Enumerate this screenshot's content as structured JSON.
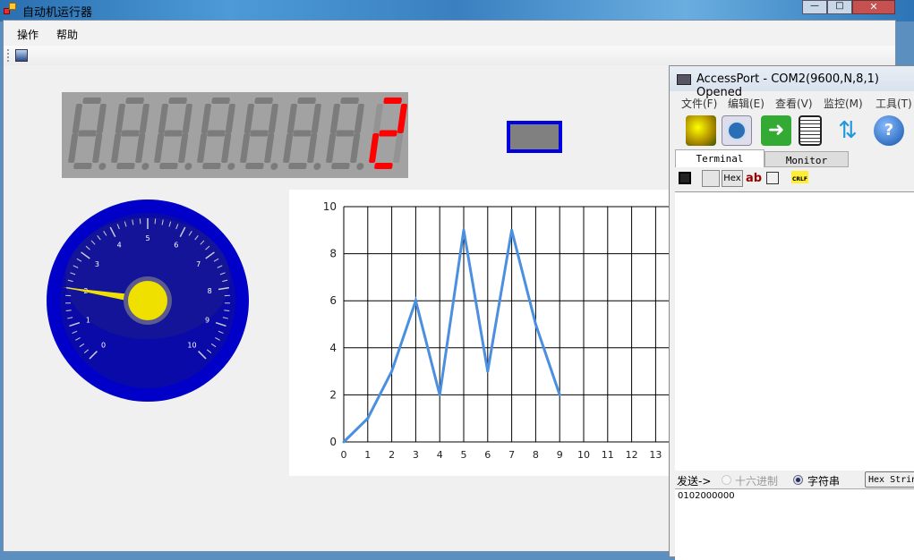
{
  "main_window": {
    "title": "自动机运行器",
    "menu": [
      "操作",
      "帮助"
    ],
    "window_buttons": [
      "minimize",
      "maximize",
      "close"
    ]
  },
  "seven_segment": {
    "digits": [
      "8.",
      "8.",
      "8.",
      "8.",
      "8.",
      "8.",
      "8.",
      "2"
    ],
    "active_value": "2",
    "active_color": "#ff0000",
    "inactive_color": "#7c7c7c"
  },
  "indicator": {
    "fill": "#808080",
    "border": "#0000e0"
  },
  "gauge": {
    "min": 0,
    "max": 10,
    "value": 2,
    "labels": [
      "0",
      "1",
      "2",
      "3",
      "4",
      "5",
      "6",
      "7",
      "8",
      "9",
      "10"
    ],
    "needle_color": "#f0e000",
    "face_color": "#0a0aa8"
  },
  "chart_data": {
    "type": "line",
    "x": [
      0,
      1,
      2,
      3,
      4,
      5,
      6,
      7,
      8,
      9
    ],
    "y": [
      0,
      1,
      3,
      6,
      2,
      9,
      3,
      9,
      5,
      2
    ],
    "xlim": [
      0,
      13
    ],
    "ylim": [
      0,
      10
    ],
    "xticks": [
      "0",
      "1",
      "2",
      "3",
      "4",
      "5",
      "6",
      "7",
      "8",
      "9",
      "10",
      "11",
      "12",
      "13"
    ],
    "yticks": [
      "0",
      "2",
      "4",
      "6",
      "8",
      "10"
    ],
    "grid": true,
    "series_color": "#4a8fe0",
    "title": "",
    "xlabel": "",
    "ylabel": ""
  },
  "accessport": {
    "title": "AccessPort - COM2(9600,N,8,1) Opened",
    "menu": [
      "文件(F)",
      "编辑(E)",
      "查看(V)",
      "监控(M)",
      "工具(T)"
    ],
    "tabs": [
      "Terminal",
      "Monitor"
    ],
    "active_tab": "Terminal",
    "sub_toolbar": {
      "hex": "Hex",
      "ab": "ab",
      "crlf": "CRLF"
    },
    "send_label": "发送->",
    "radio_hex": "十六进制",
    "radio_string": "字符串",
    "radio_selected": "字符串",
    "hex_string_button": "Hex Strin",
    "input_value": "0102000000"
  }
}
